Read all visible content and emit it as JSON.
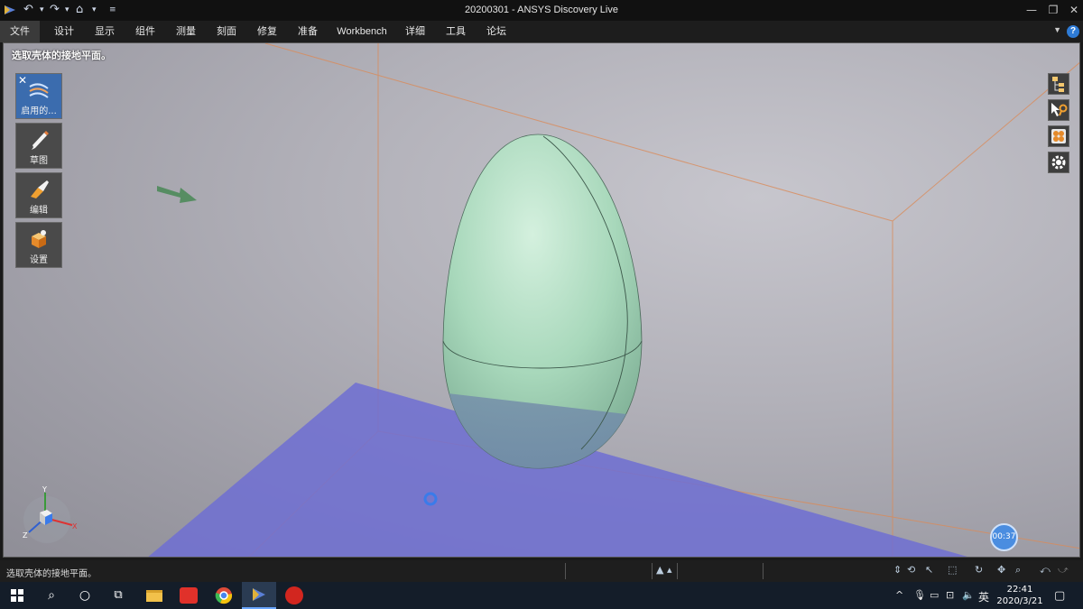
{
  "window": {
    "title": "20200301 - ANSYS Discovery Live"
  },
  "menu": {
    "items": [
      "文件",
      "设计",
      "显示",
      "组件",
      "测量",
      "刻面",
      "修复",
      "准备",
      "Workbench",
      "详细",
      "工具",
      "论坛"
    ],
    "active": "文件"
  },
  "viewport": {
    "prompt": "选取壳体的接地平面。",
    "timer": "00:37"
  },
  "left_tools": [
    {
      "label": "启用的...",
      "icon": "physics-icon"
    },
    {
      "label": "草图",
      "icon": "pencil-icon"
    },
    {
      "label": "编辑",
      "icon": "edit-icon"
    },
    {
      "label": "设置",
      "icon": "setup-icon"
    }
  ],
  "right_tools": [
    "structure-tree-icon",
    "select-icon",
    "display-icon",
    "settings-gear-icon"
  ],
  "triad": {
    "y": "Y",
    "x": "X",
    "z": "Z"
  },
  "status": {
    "text": "选取壳体的接地平面。"
  },
  "taskbar": {
    "clock_time": "22:41",
    "clock_date": "2020/3/21",
    "ime": "英"
  },
  "colors": {
    "egg": "#a8d8bb",
    "ground_plane": "#6f6fd2",
    "bounding_box": "#d98b5a",
    "accent": "#3b6cae"
  }
}
